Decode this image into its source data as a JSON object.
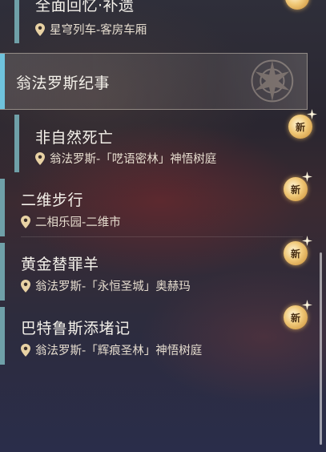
{
  "quest_list": {
    "items_top": [
      {
        "title": "全面回忆·补遗",
        "location": "星穹列车-客房车厢",
        "is_new": true
      }
    ],
    "category": {
      "label": "翁法罗斯纪事"
    },
    "items": [
      {
        "title": "非自然死亡",
        "location": "翁法罗斯-「呓语密林」神悟树庭",
        "is_new": true,
        "new_label": "新"
      },
      {
        "title": "二维步行",
        "location": "二相乐园-二维市",
        "is_new": true,
        "new_label": "新"
      },
      {
        "title": "黄金替罪羊",
        "location": "翁法罗斯-「永恒圣城」奥赫玛",
        "is_new": true,
        "new_label": "新"
      },
      {
        "title": "巴特鲁斯添堵记",
        "location": "翁法罗斯-「辉痕圣林」神悟树庭",
        "is_new": true,
        "new_label": "新"
      }
    ]
  },
  "colors": {
    "accent_cyan": "#6fc3dd",
    "item_bar": "#6fa0a8",
    "badge_gold": "#f0c877"
  }
}
